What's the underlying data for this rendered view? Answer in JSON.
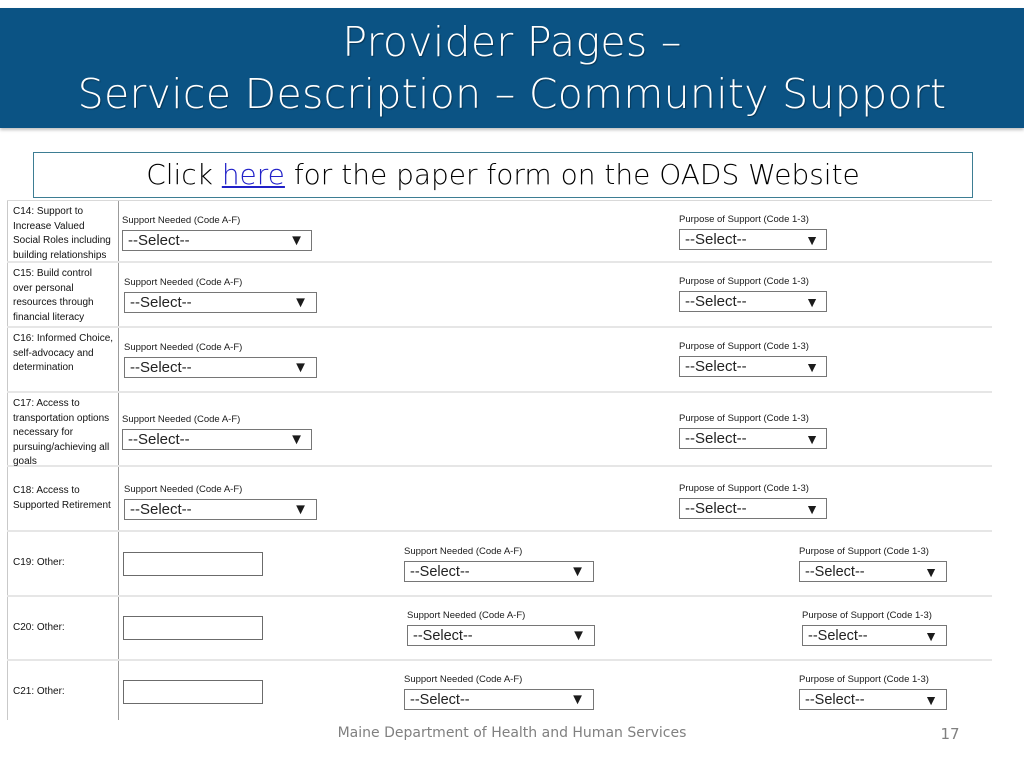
{
  "slide": {
    "title_line_1": "Provider Pages –",
    "title_line_2": "Service Description – Community Support",
    "banner_color": "#0b5384",
    "link_prefix": "Click ",
    "link_text": "here",
    "link_suffix": " for the paper form on the OADS Website",
    "link_color": "#2121c8",
    "box_border_color": "#3d7d93"
  },
  "footer": {
    "organization": "Maine Department of Health and Human Services",
    "page_number": "17"
  },
  "form": {
    "select_placeholder": "--Select--",
    "support_needed_label": "Support Needed (Code A-F)",
    "purpose_label": "Purpose of Support (Code 1-3)",
    "purpose_label_typo": "Prupose of Support (Code 1-3)",
    "rows": [
      {
        "id": "C14",
        "label": "C14: Support to Increase Valued Social Roles including building relationships",
        "support_label": "Support Needed (Code A-F)",
        "support_value": "--Select--",
        "purpose_label": "Purpose of Support (Code 1-3)",
        "purpose_value": "--Select--",
        "other_text": ""
      },
      {
        "id": "C15",
        "label": "C15: Build control over personal resources through financial literacy",
        "support_label": "Support Needed (Code A-F)",
        "support_value": "--Select--",
        "purpose_label": "Purpose of Support (Code 1-3)",
        "purpose_value": "--Select--",
        "other_text": ""
      },
      {
        "id": "C16",
        "label": "C16: Informed Choice, self-advocacy and determination",
        "support_label": "Support Needed (Code A-F)",
        "support_value": "--Select--",
        "purpose_label": "Purpose of Support (Code 1-3)",
        "purpose_value": "--Select--",
        "other_text": ""
      },
      {
        "id": "C17",
        "label": "C17: Access to transportation options necessary for pursuing/achieving all goals",
        "support_label": "Support Needed (Code A-F)",
        "support_value": "--Select--",
        "purpose_label": "Purpose of Support (Code 1-3)",
        "purpose_value": "--Select--",
        "other_text": ""
      },
      {
        "id": "C18",
        "label": "C18: Access to Supported Retirement",
        "support_label": "Support Needed (Code A-F)",
        "support_value": "--Select--",
        "purpose_label": "Prupose of Support (Code 1-3)",
        "purpose_value": "--Select--",
        "other_text": ""
      },
      {
        "id": "C19",
        "label": "C19: Other:",
        "support_label": "Support Needed (Code A-F)",
        "support_value": "--Select--",
        "purpose_label": "Purpose of Support (Code 1-3)",
        "purpose_value": "--Select--",
        "other_text": ""
      },
      {
        "id": "C20",
        "label": "C20: Other:",
        "support_label": "Support Needed (Code A-F)",
        "support_value": "--Select--",
        "purpose_label": "Purpose of Support (Code 1-3)",
        "purpose_value": "--Select--",
        "other_text": ""
      },
      {
        "id": "C21",
        "label": "C21: Other:",
        "support_label": "Support Needed (Code A-F)",
        "support_value": "--Select--",
        "purpose_label": "Purpose of Support (Code 1-3)",
        "purpose_value": "--Select--",
        "other_text": ""
      }
    ]
  }
}
